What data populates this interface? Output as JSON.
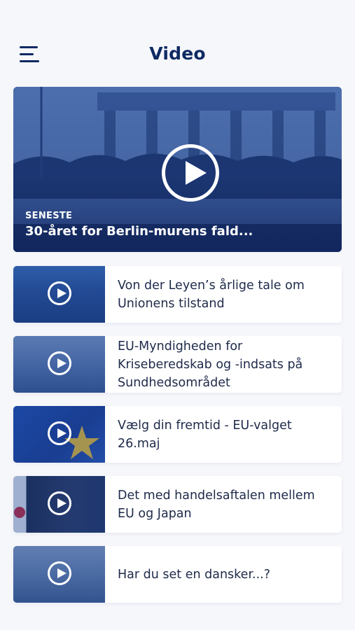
{
  "header": {
    "title": "Video",
    "menu_icon": "hamburger-menu-icon"
  },
  "featured": {
    "tag": "SENESTE",
    "title": "30-året for Berlin-murens fald...",
    "icon": "play-icon"
  },
  "videos": [
    {
      "title": "Von  der Leyen’s årlige tale om Unionens tilstand",
      "icon": "play-icon"
    },
    {
      "title": "EU-Myndigheden for Kriseberedskab og -indsats på Sundhedsområdet",
      "icon": "play-icon"
    },
    {
      "title": "Vælg din fremtid - EU-valget 26.maj",
      "icon": "play-icon"
    },
    {
      "title": "Det med handelsaftalen mellem EU og Japan",
      "icon": "play-icon"
    },
    {
      "title": "Har du set en dansker...?",
      "icon": "play-icon"
    }
  ],
  "colors": {
    "background": "#f6f7fb",
    "brand_navy": "#0e2a63",
    "text": "#1e2a4a",
    "overlay_blue": "#1c3c7a"
  }
}
